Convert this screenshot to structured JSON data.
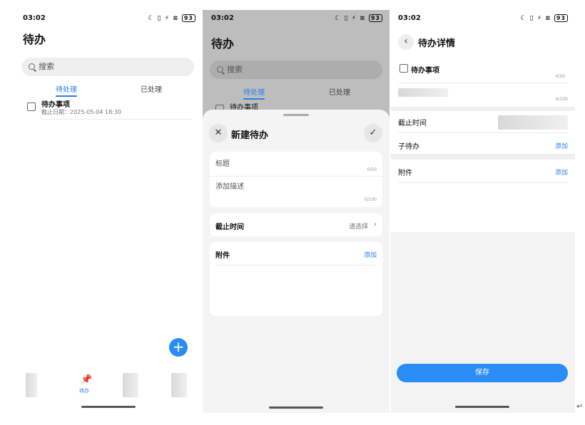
{
  "status_bar": {
    "time": "03:02",
    "icons_left": "☾ ▯ ⚡ ≋",
    "battery": "93"
  },
  "list_screen": {
    "title": "待办",
    "search_placeholder": "搜索",
    "tabs": [
      {
        "label": "待处理",
        "active": true
      },
      {
        "label": "已处理",
        "active": false
      }
    ],
    "items": [
      {
        "title": "待办事项",
        "due": "截止日期：2025-05-04 18:30"
      }
    ],
    "fab_symbol": "+",
    "nav_active_label": "待办"
  },
  "new_sheet": {
    "title": "新建待办",
    "close_symbol": "✕",
    "confirm_symbol": "✓",
    "title_field": {
      "placeholder": "标题",
      "counter": "0/50"
    },
    "desc_field": {
      "placeholder": "添加描述",
      "counter": "0/100"
    },
    "deadline": {
      "label": "截止时间",
      "hint": "请选择"
    },
    "attachment": {
      "label": "附件",
      "action": "添加"
    }
  },
  "detail_screen": {
    "title": "待办详情",
    "item_title": "待办事项",
    "title_counter": "4/50",
    "desc_counter": "6/100",
    "deadline_label": "截止时间",
    "subtask_label": "子待办",
    "subtask_action": "添加",
    "attachment_label": "附件",
    "attachment_action": "添加",
    "save_label": "保存"
  },
  "colors": {
    "accent": "#2a7ff0",
    "fab": "#2a8cf5"
  }
}
